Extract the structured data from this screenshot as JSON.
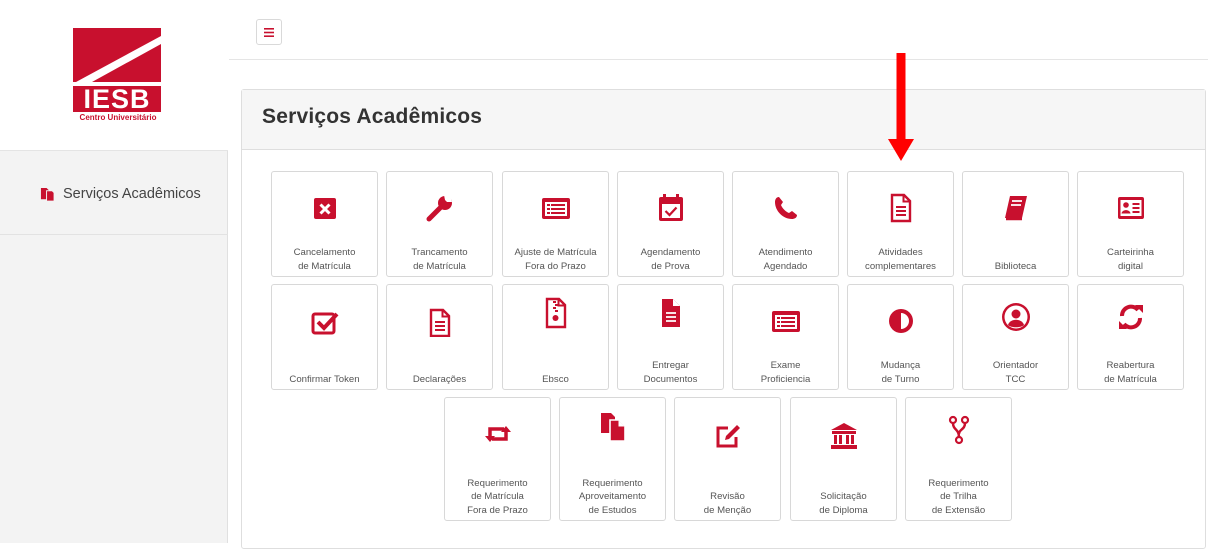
{
  "brand": {
    "name": "IESB",
    "subtitle": "Centro Universitário",
    "color": "#c8102e"
  },
  "sidebar": {
    "items": [
      {
        "label": "Serviços Acadêmicos",
        "icon": "copy-icon"
      }
    ]
  },
  "header": {
    "menu_icon": "hamburger-icon"
  },
  "panel": {
    "title": "Serviços Acadêmicos"
  },
  "tiles": [
    {
      "label": "Cancelamento\nde Matrícula",
      "icon": "cancel-square-icon"
    },
    {
      "label": "Trancamento\nde Matrícula",
      "icon": "wrench-icon"
    },
    {
      "label": "Ajuste de Matrícula\nFora do Prazo",
      "icon": "list-alt-icon"
    },
    {
      "label": "Agendamento\nde Prova",
      "icon": "calendar-check-icon"
    },
    {
      "label": "Atendimento\nAgendado",
      "icon": "phone-icon"
    },
    {
      "label": "Atividades\ncomplementares",
      "icon": "file-text-icon"
    },
    {
      "label": "Biblioteca",
      "icon": "book-icon"
    },
    {
      "label": "Carteirinha\ndigital",
      "icon": "id-card-icon"
    },
    {
      "label": "Confirmar Token",
      "icon": "check-square-icon"
    },
    {
      "label": "Declarações",
      "icon": "file-text-icon"
    },
    {
      "label": "Ebsco",
      "icon": "file-zip-icon"
    },
    {
      "label": "Entregar\nDocumentos",
      "icon": "file-solid-icon"
    },
    {
      "label": "Exame\nProficiencia",
      "icon": "list-alt-icon"
    },
    {
      "label": "Mudança\nde Turno",
      "icon": "adjust-icon"
    },
    {
      "label": "Orientador\nTCC",
      "icon": "user-circle-icon"
    },
    {
      "label": "Reabertura\nde Matrícula",
      "icon": "refresh-icon"
    },
    {
      "label": "Requerimento\nde Matrícula\nFora de Prazo",
      "icon": "retweet-icon"
    },
    {
      "label": "Requerimento\nAproveitamento\nde Estudos",
      "icon": "copy-icon"
    },
    {
      "label": "Revisão\nde Menção",
      "icon": "edit-icon"
    },
    {
      "label": "Solicitação\nde Diploma",
      "icon": "university-icon"
    },
    {
      "label": "Requerimento\nde Trilha\nde Extensão",
      "icon": "code-fork-icon"
    }
  ],
  "annotation": {
    "icon": "arrow-down-icon",
    "color": "#ff0000"
  }
}
